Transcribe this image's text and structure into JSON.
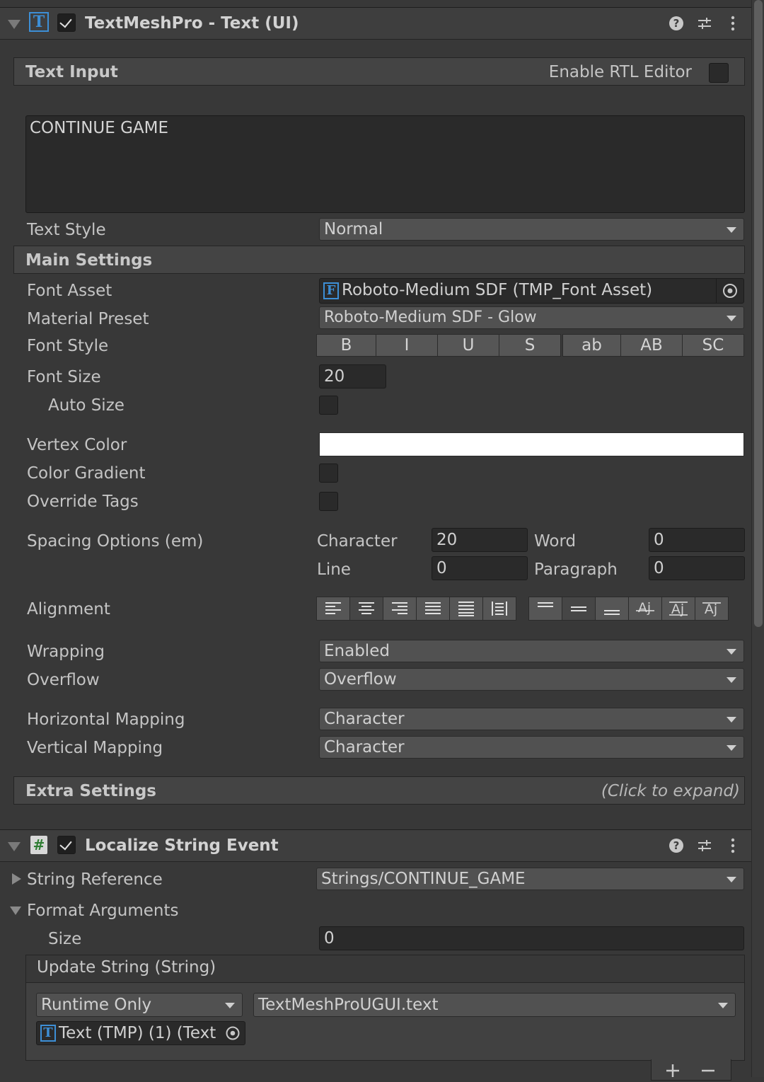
{
  "tmp_component": {
    "title": "TextMeshPro - Text (UI)",
    "enabled": true,
    "text_input": {
      "header": "Text Input",
      "rtl_label": "Enable RTL Editor",
      "text": "CONTINUE GAME"
    },
    "text_style": {
      "label": "Text Style",
      "value": "Normal"
    },
    "main_settings": {
      "header": "Main Settings",
      "font_asset": {
        "label": "Font Asset",
        "value": "Roboto-Medium SDF (TMP_Font Asset)",
        "icon_letter": "F"
      },
      "material_preset": {
        "label": "Material Preset",
        "value": "Roboto-Medium SDF - Glow"
      },
      "font_style": {
        "label": "Font Style",
        "buttons_a": [
          "B",
          "I",
          "U",
          "S"
        ],
        "buttons_b": [
          "ab",
          "AB",
          "SC"
        ]
      },
      "font_size": {
        "label": "Font Size",
        "value": "20"
      },
      "auto_size": {
        "label": "Auto Size"
      },
      "vertex_color": {
        "label": "Vertex Color",
        "color": "#ffffff"
      },
      "color_gradient": {
        "label": "Color Gradient"
      },
      "override_tags": {
        "label": "Override Tags"
      },
      "spacing": {
        "label": "Spacing Options (em)",
        "character_label": "Character",
        "character_value": "20",
        "word_label": "Word",
        "word_value": "0",
        "line_label": "Line",
        "line_value": "0",
        "paragraph_label": "Paragraph",
        "paragraph_value": "0"
      },
      "alignment": {
        "label": "Alignment",
        "horizontal_selected": "center",
        "vertical_selected": "middle"
      },
      "wrapping": {
        "label": "Wrapping",
        "value": "Enabled"
      },
      "overflow": {
        "label": "Overflow",
        "value": "Overflow"
      },
      "horizontal_mapping": {
        "label": "Horizontal Mapping",
        "value": "Character"
      },
      "vertical_mapping": {
        "label": "Vertical Mapping",
        "value": "Character"
      }
    },
    "extra_settings": {
      "header": "Extra Settings",
      "hint": "(Click to expand)"
    }
  },
  "localize_component": {
    "title": "Localize String Event",
    "enabled": true,
    "string_reference": {
      "label": "String Reference",
      "value": "Strings/CONTINUE_GAME"
    },
    "format_arguments": {
      "label": "Format Arguments",
      "size_label": "Size",
      "size_value": "0"
    },
    "update_string": {
      "header": "Update String (String)",
      "mode": "Runtime Only",
      "function": "TextMeshProUGUI.text",
      "target": "Text (TMP) (1) (Text",
      "target_icon_letter": "T"
    }
  },
  "colors": {
    "panel": "#383838",
    "header": "#3e3e3e",
    "field": "#2a2a2a",
    "button": "#565656",
    "tmp_icon": "#4a90d9"
  }
}
